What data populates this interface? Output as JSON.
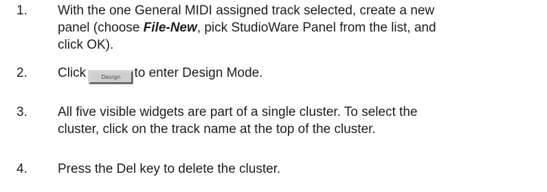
{
  "steps": [
    {
      "number": "1.",
      "lines": [
        {
          "before": "With the one General MIDI assigned track selected, create a new"
        },
        {
          "before": "panel (choose ",
          "emphasis": "File-New",
          "after": ", pick StudioWare Panel from the list, and"
        },
        {
          "before": "click OK)."
        }
      ]
    },
    {
      "number": "2.",
      "before": "Click",
      "button_label": "Design",
      "after": "to enter Design Mode."
    },
    {
      "number": "3.",
      "lines": [
        "All five visible widgets are part of a single cluster. To select the",
        "cluster, click on the track name at the top of the cluster."
      ]
    },
    {
      "number": "4.",
      "lines": [
        "Press the Del key to delete the cluster."
      ]
    }
  ]
}
